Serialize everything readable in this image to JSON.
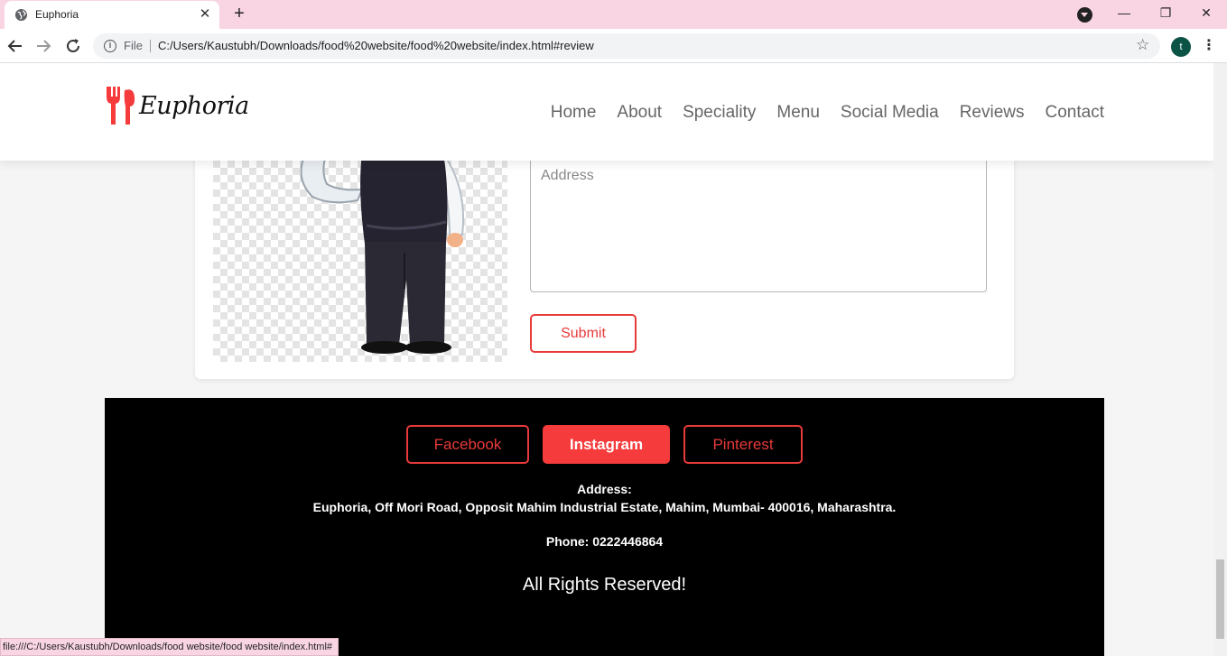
{
  "browser": {
    "tab_title": "Euphoria",
    "tab_close": "✕",
    "new_tab": "+",
    "window_controls": {
      "minimize": "—",
      "maximize": "❐",
      "close": "✕"
    },
    "omnibox": {
      "scheme_label": "File",
      "url": "C:/Users/Kaustubh/Downloads/food%20website/food%20website/index.html#review"
    },
    "profile_initial": "t",
    "menu": "⋮",
    "status_url": "file:///C:/Users/Kaustubh/Downloads/food website/food website/index.html#"
  },
  "site": {
    "logo_text": "Euphoria",
    "nav": [
      "Home",
      "About",
      "Speciality",
      "Menu",
      "Social Media",
      "Reviews",
      "Contact"
    ]
  },
  "order_form": {
    "address_placeholder": "Address",
    "submit_label": "Submit"
  },
  "footer": {
    "social": [
      "Facebook",
      "Instagram",
      "Pinterest"
    ],
    "address_label": "Address:",
    "address": "Euphoria, Off Mori Road, Opposit Mahim Industrial Estate, Mahim, Mumbai- 400016, Maharashtra.",
    "phone": "Phone: 0222446864",
    "rights": "All Rights Reserved!"
  },
  "colors": {
    "accent": "#e83a3a",
    "tabbar": "#f9d5e4",
    "footer_bg": "#000000"
  },
  "icons": [
    "globe-icon",
    "back-arrow-icon",
    "forward-arrow-icon",
    "reload-icon",
    "info-icon",
    "star-icon",
    "fork-knife-logo-icon",
    "tab-search-icon",
    "kebab-menu-icon"
  ]
}
